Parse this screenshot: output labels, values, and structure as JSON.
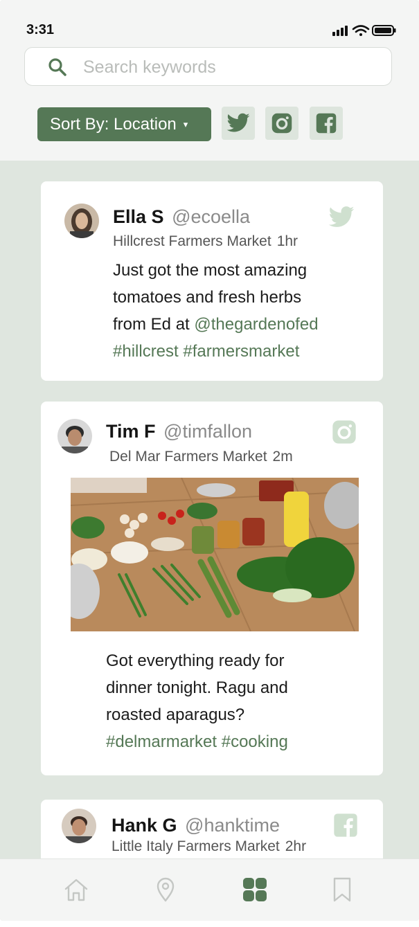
{
  "status_bar": {
    "time": "3:31",
    "icons": [
      "signal-icon",
      "wifi-icon",
      "battery-icon"
    ]
  },
  "search": {
    "placeholder": "Search keywords",
    "value": ""
  },
  "toolbar": {
    "sort_label": "Sort By: Location",
    "sort_caret": "▾",
    "filters": [
      "twitter-icon",
      "instagram-icon",
      "facebook-icon"
    ]
  },
  "posts": [
    {
      "name": "Ella S",
      "handle": "@ecoella",
      "market": "Hillcrest Farmers Market",
      "time": "1hr",
      "network": "twitter-icon",
      "text_lines": [
        "Just got the most amazing",
        "tomatoes and fresh herbs",
        "from Ed at "
      ],
      "mention": "@thegardenofed",
      "tags": "#hillcrest #farmersmarket"
    },
    {
      "name": "Tim F",
      "handle": "@timfallon",
      "market": "Del Mar Farmers Market",
      "time": "2m",
      "network": "instagram-icon",
      "text_lines": [
        "Got everything ready for",
        "dinner tonight. Ragu and",
        "roasted aparagus?"
      ],
      "tags": "#delmarmarket #cooking"
    },
    {
      "name": "Hank G",
      "handle": "@hanktime",
      "market": "Little Italy Farmers Market",
      "time": "2hr",
      "network": "facebook-icon"
    }
  ],
  "bottom_nav": [
    "home-icon",
    "location-pin-icon",
    "grid-icon",
    "bookmark-icon"
  ],
  "colors": {
    "accent": "#557856",
    "feed_background": "#dfe6df",
    "icon_tint": "#dde5dd",
    "network_icon_light": "#cfe0cf"
  }
}
